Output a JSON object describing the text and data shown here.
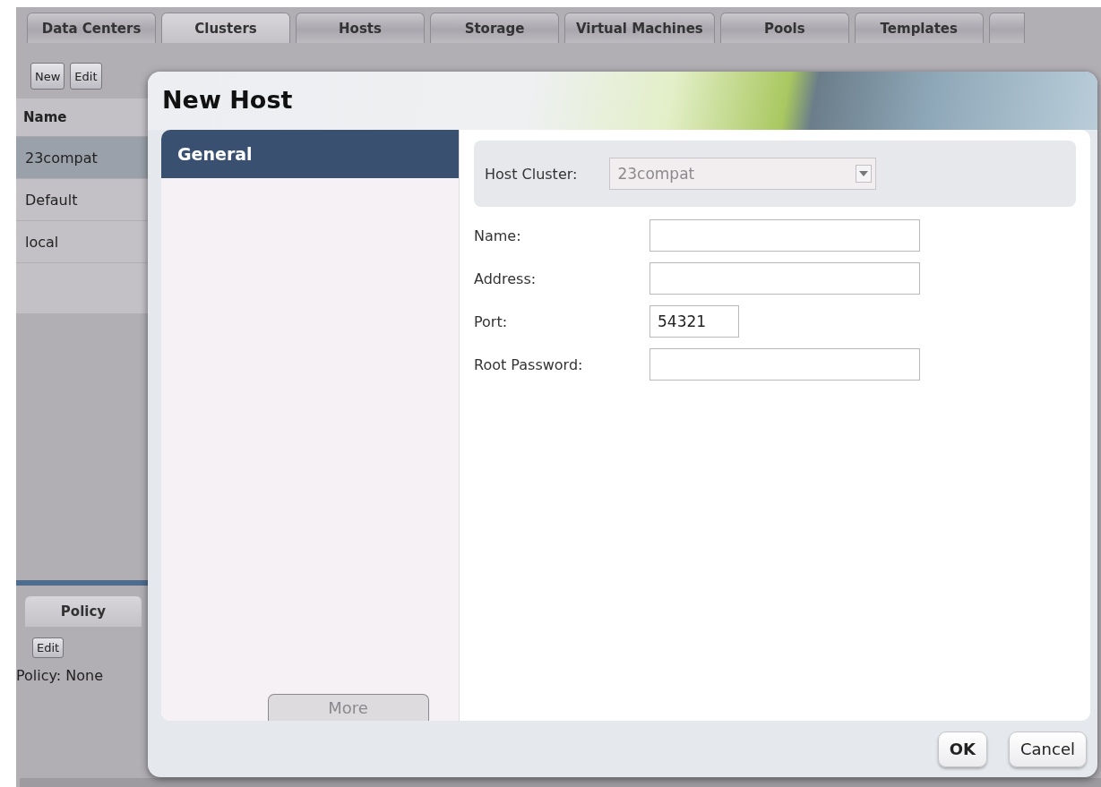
{
  "main_tabs": [
    {
      "label": "Data Centers",
      "selected": false
    },
    {
      "label": "Clusters",
      "selected": true
    },
    {
      "label": "Hosts",
      "selected": false
    },
    {
      "label": "Storage",
      "selected": false
    },
    {
      "label": "Virtual Machines",
      "selected": false
    },
    {
      "label": "Pools",
      "selected": false
    },
    {
      "label": "Templates",
      "selected": false
    }
  ],
  "toolbar": [
    "New",
    "Edit"
  ],
  "clusters_grid": {
    "column": "Name",
    "rows": [
      {
        "name": "23compat",
        "selected": true
      },
      {
        "name": "Default",
        "selected": false
      },
      {
        "name": "local",
        "selected": false
      }
    ]
  },
  "policy_panel": {
    "tab": "Policy",
    "button": "Edit",
    "status": "Policy: None"
  },
  "dialog": {
    "title": "New Host",
    "nav": [
      {
        "label": "General",
        "selected": true
      }
    ],
    "more_button": {
      "label": "More",
      "disabled": true
    },
    "host_cluster": {
      "label": "Host Cluster:",
      "value": "23compat",
      "disabled": true
    },
    "fields": [
      {
        "label": "Name:",
        "kind": "wide"
      },
      {
        "label": "Address:",
        "kind": "wide"
      },
      {
        "label": "Port:",
        "value": "54321",
        "kind": "short"
      },
      {
        "label": "Root Password:",
        "kind": "wide"
      }
    ],
    "buttons": [
      {
        "label": "OK",
        "kind": "primary"
      },
      {
        "label": "Cancel",
        "kind": "secondary"
      }
    ]
  }
}
